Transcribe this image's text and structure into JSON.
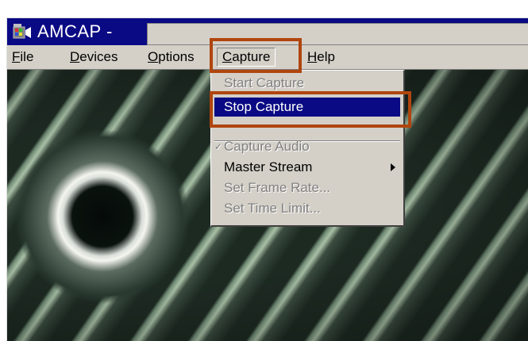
{
  "window": {
    "title": "AMCAP -",
    "icon": "camera-app-icon"
  },
  "menubar": {
    "file": {
      "mnemonic": "F",
      "rest": "ile"
    },
    "devices": {
      "mnemonic": "D",
      "rest": "evices"
    },
    "options": {
      "mnemonic": "O",
      "rest": "ptions"
    },
    "capture": {
      "mnemonic": "C",
      "rest": "apture"
    },
    "help": {
      "mnemonic": "H",
      "rest": "elp"
    }
  },
  "capture_menu": {
    "items": [
      {
        "label": "Start Capture",
        "state": "disabled"
      },
      {
        "label": "Stop Capture",
        "state": "highlighted"
      },
      {
        "label": "Capture Audio",
        "state": "disabled",
        "checked": true
      },
      {
        "label": "Master Stream",
        "state": "enabled",
        "submenu": true
      },
      {
        "label": "Set Frame Rate...",
        "state": "disabled"
      },
      {
        "label": "Set Time Limit...",
        "state": "disabled"
      }
    ]
  },
  "colors": {
    "title_bar": "#0a0a84",
    "menu_bg": "#d4d0c8",
    "highlight": "#0a0a84",
    "annotation": "#b0450e"
  }
}
